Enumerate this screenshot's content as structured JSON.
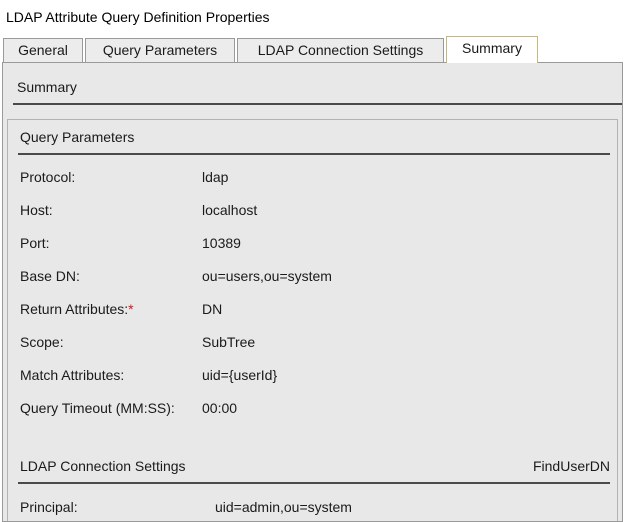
{
  "window": {
    "title": "LDAP Attribute Query Definition Properties"
  },
  "tabs": [
    {
      "label": "General",
      "active": false
    },
    {
      "label": "Query Parameters",
      "active": false
    },
    {
      "label": "LDAP Connection Settings",
      "active": false
    },
    {
      "label": "Summary",
      "active": true
    }
  ],
  "summary": {
    "heading": "Summary",
    "query_parameters": {
      "heading": "Query Parameters",
      "rows": [
        {
          "label": "Protocol:",
          "value": "ldap"
        },
        {
          "label": "Host:",
          "value": "localhost"
        },
        {
          "label": "Port:",
          "value": "10389"
        },
        {
          "label": "Base DN:",
          "value": "ou=users,ou=system"
        },
        {
          "label": "Return Attributes:",
          "required_mark": "*",
          "value": "DN"
        },
        {
          "label": "Scope:",
          "value": "SubTree"
        },
        {
          "label": "Match Attributes:",
          "value": "uid={userId}"
        },
        {
          "label": "Query Timeout (MM:SS):",
          "value": "00:00"
        }
      ]
    },
    "ldap_connection_settings": {
      "heading": "LDAP Connection Settings",
      "name": "FindUserDN",
      "rows": [
        {
          "label": "Principal:",
          "value": "uid=admin,ou=system"
        }
      ]
    }
  },
  "colors": {
    "required_mark": "#d11a1a",
    "active_tab_border": "#c8b67a",
    "panel_background": "#e8e8e8"
  }
}
